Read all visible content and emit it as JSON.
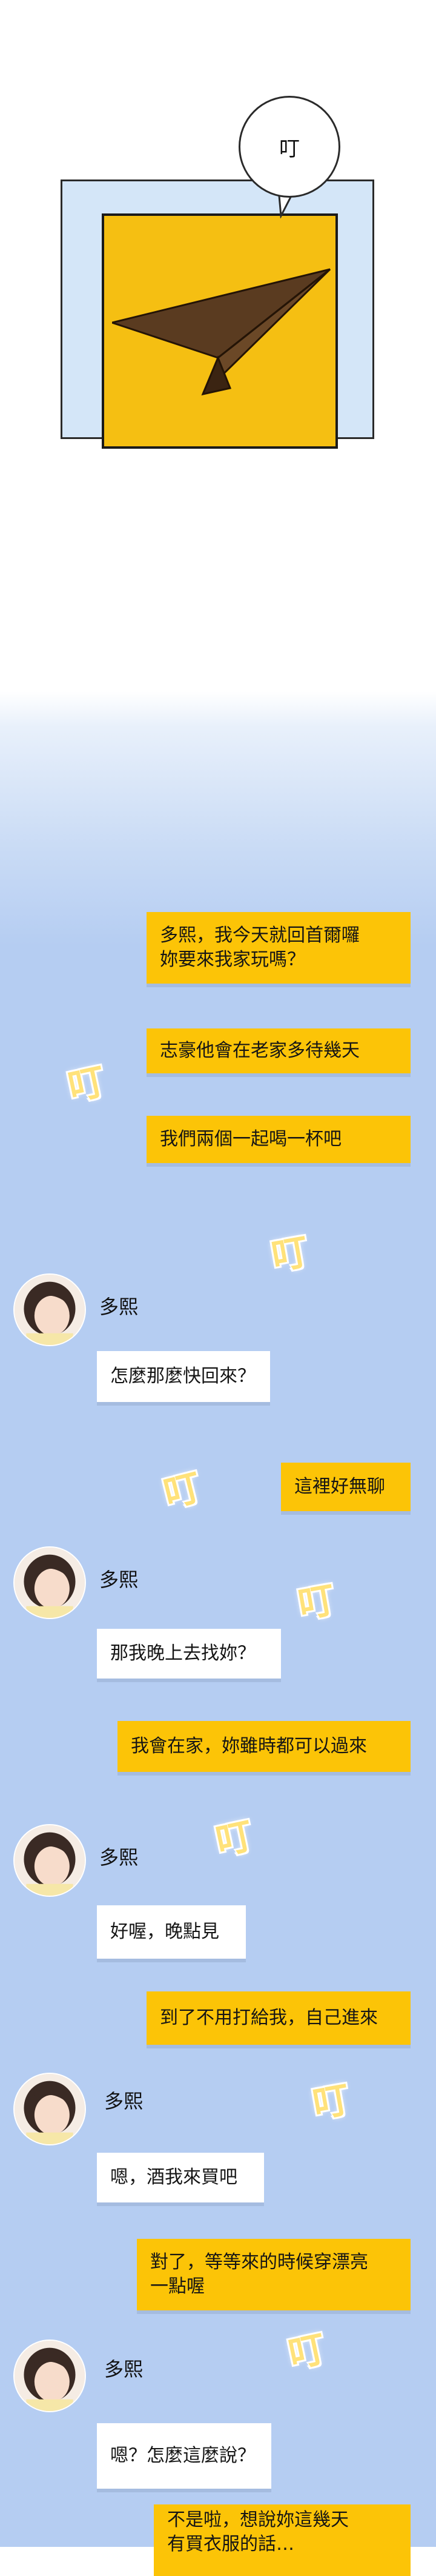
{
  "sfx_top": "叮",
  "sfx": "叮",
  "contact_name": "多熙",
  "messages": [
    {
      "from": "me",
      "text": "多熙，我今天就回首爾囉\n妳要來我家玩嗎？"
    },
    {
      "from": "me",
      "text": "志豪他會在老家多待幾天"
    },
    {
      "from": "me",
      "text": "我們兩個一起喝一杯吧"
    },
    {
      "from": "her",
      "text": "怎麼那麼快回來？"
    },
    {
      "from": "me",
      "text": "這裡好無聊"
    },
    {
      "from": "her",
      "text": "那我晚上去找妳？"
    },
    {
      "from": "me",
      "text": "我會在家，妳雖時都可以過來"
    },
    {
      "from": "her",
      "text": "好喔，晚點見"
    },
    {
      "from": "me",
      "text": "到了不用打給我，自己進來"
    },
    {
      "from": "her",
      "text": "嗯，酒我來買吧"
    },
    {
      "from": "me",
      "text": "對了，等等來的時候穿漂亮\n一點喔"
    },
    {
      "from": "her",
      "text": "嗯？怎麼這麼說？"
    },
    {
      "from": "me",
      "text": "不是啦，想說妳這幾天\n有買衣服的話…"
    }
  ],
  "colors": {
    "my_bubble": "#fcc407",
    "her_bubble": "#ffffff",
    "panel_bg": "#b5cdf2",
    "frame_yellow": "#f5bf12"
  }
}
